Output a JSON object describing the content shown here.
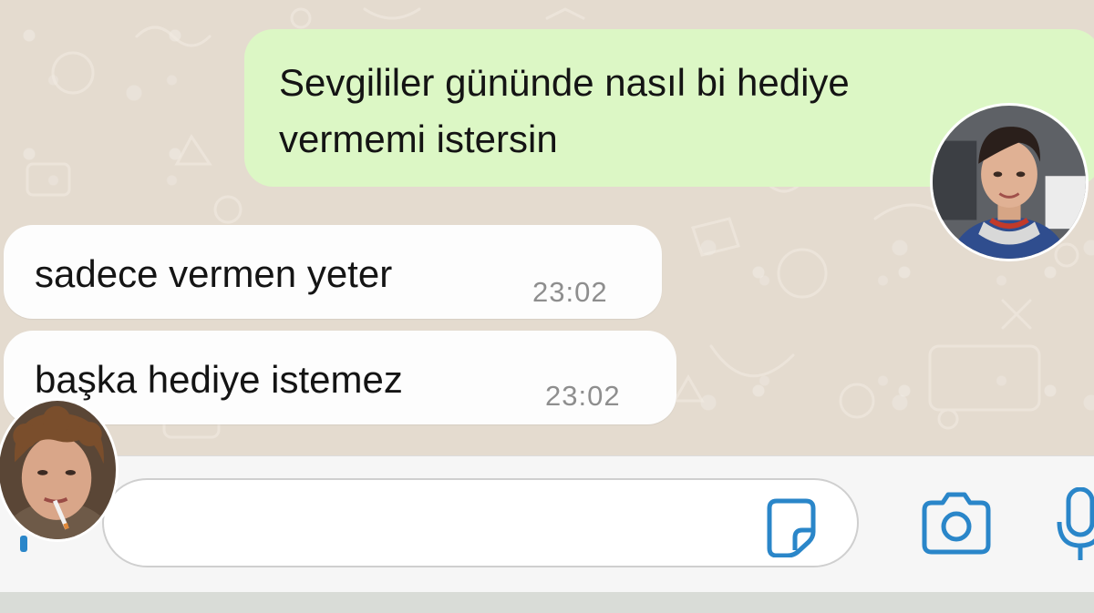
{
  "conversation": {
    "messages": [
      {
        "direction": "outgoing",
        "lines": [
          "Sevgililer gününde nasıl bi hediye",
          "vermemi istersin"
        ]
      },
      {
        "direction": "incoming",
        "text": "sadece vermen yeter",
        "time": "23:02"
      },
      {
        "direction": "incoming",
        "text": "başka hediye istemez",
        "time": "23:02"
      }
    ]
  },
  "composer": {
    "value": "",
    "icons": {
      "plus": "plus-icon",
      "sticker": "sticker-icon",
      "camera": "camera-icon",
      "microphone": "microphone-icon"
    }
  },
  "avatars": {
    "right": "person-photo",
    "left": "person-photo"
  },
  "colors": {
    "chat_background": "#e4dbcf",
    "outgoing_bubble": "#dcf7c5",
    "incoming_bubble": "#fdfdfd",
    "timestamp": "#8e8e8e",
    "icon_accent": "#2a86c9",
    "input_bar": "#f6f6f6"
  }
}
